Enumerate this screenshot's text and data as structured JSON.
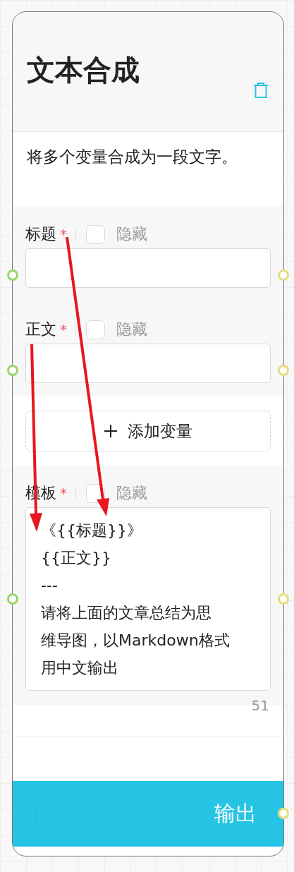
{
  "node": {
    "title": "文本合成",
    "description": "将多个变量合成为一段文字。"
  },
  "variables": [
    {
      "label": "标题",
      "required_mark": "*",
      "hide_option": {
        "label": "隐藏",
        "checked": false
      }
    },
    {
      "label": "正文",
      "required_mark": "*",
      "hide_option": {
        "label": "隐藏",
        "checked": false
      }
    }
  ],
  "add_button": {
    "label": "添加变量"
  },
  "template": {
    "label": "模板",
    "required_mark": "*",
    "hide_option": {
      "label": "隐藏",
      "checked": false
    },
    "lines": [
      "《{{标题}}》",
      "{{正文}}",
      "---",
      "请将上面的文章总结为思",
      "维导图，以Markdown格式",
      "用中文输出"
    ],
    "count": "51"
  },
  "output": {
    "label": "输出"
  }
}
